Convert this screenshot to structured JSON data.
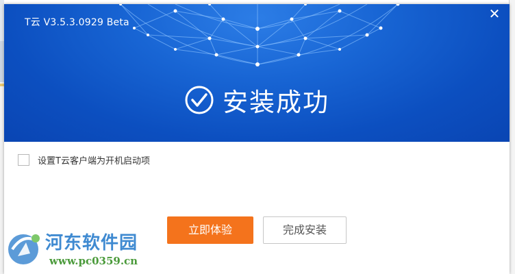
{
  "window": {
    "title": "T云 V3.5.3.0929 Beta",
    "close_icon": "close-icon"
  },
  "banner": {
    "status_icon": "check-circle-icon",
    "status_text": "安装成功"
  },
  "options": {
    "autostart_label": "设置T云客户端为开机启动项",
    "autostart_checked": false
  },
  "actions": {
    "primary_label": "立即体验",
    "secondary_label": "完成安装"
  },
  "watermark": {
    "name": "河东软件园",
    "url": "www.pc0359.cn"
  },
  "colors": {
    "header_blue": "#1865d4",
    "primary_orange": "#f4731c",
    "watermark_blue": "#3f8ad1",
    "watermark_green": "#4a9a3a"
  }
}
